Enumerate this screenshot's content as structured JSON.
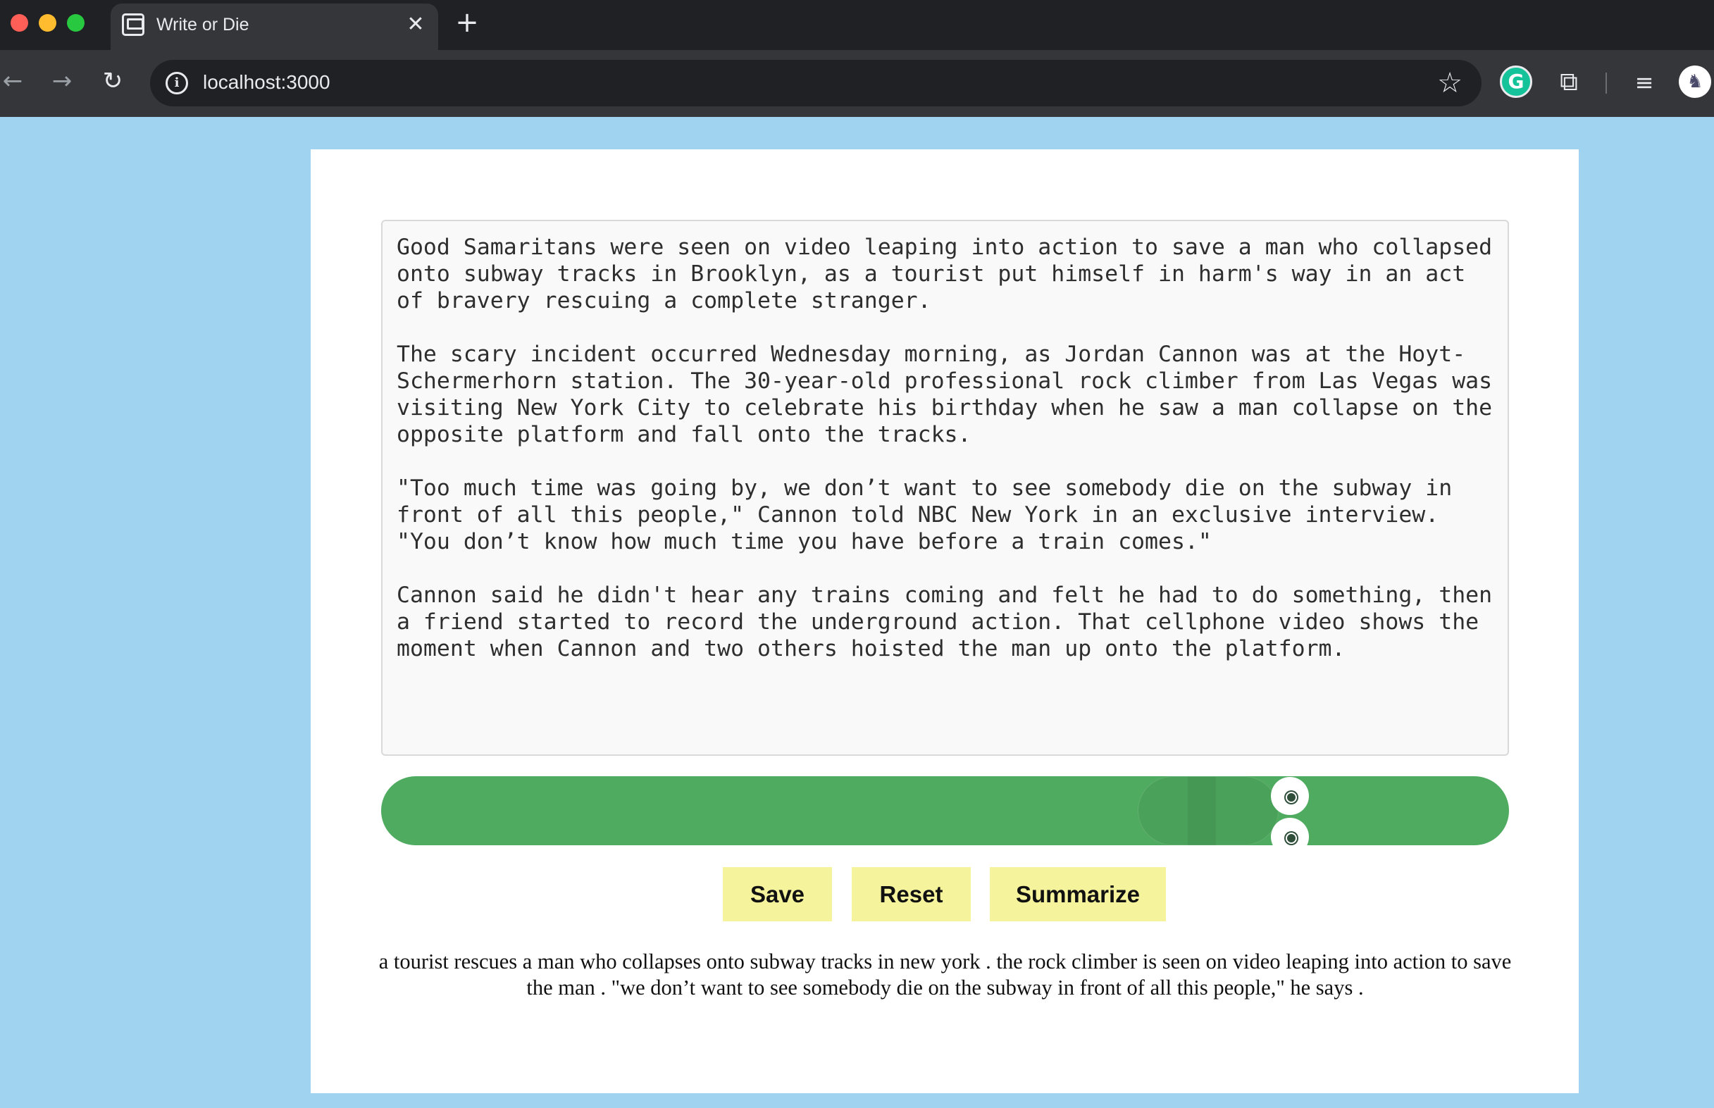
{
  "browser": {
    "tab_title": "Write or Die",
    "tab_close": "✕",
    "new_tab": "+",
    "url": "localhost:3000",
    "icons": {
      "back": "←",
      "forward": "→",
      "reload": "↻",
      "info": "i",
      "bookmark": "☆",
      "grammarly": "G",
      "extensions": "⧉",
      "media": "≡",
      "profile": "♞"
    }
  },
  "editor": {
    "text": "Good Samaritans were seen on video leaping into action to save a man who collapsed onto subway tracks in Brooklyn, as a tourist put himself in harm's way in an act of bravery rescuing a complete stranger.\n\nThe scary incident occurred Wednesday morning, as Jordan Cannon was at the Hoyt-Schermerhorn station. The 30-year-old professional rock climber from Las Vegas was visiting New York City to celebrate his birthday when he saw a man collapse on the opposite platform and fall onto the tracks.\n\n\"Too much time was going by, we don’t want to see somebody die on the subway in front of all this people,\" Cannon told NBC New York in an exclusive interview. \"You don’t know how much time you have before a train comes.\"\n\nCannon said he didn't hear any trains coming and felt he had to do something, then a friend started to record the underground action. That cellphone video shows the moment when Cannon and two others hoisted the man up onto the platform."
  },
  "timer": {
    "color": "#4fab5f"
  },
  "buttons": {
    "save": "Save",
    "reset": "Reset",
    "summarize": "Summarize",
    "color": "#f5f39b"
  },
  "summary": {
    "text": "a tourist rescues a man who collapses onto subway tracks in new york . the rock climber is seen on video leaping into action to save the man . \"we don’t want to see somebody die on the subway in front of all this people,\" he says ."
  },
  "colors": {
    "page_background": "#9fd3f0",
    "card_background": "#ffffff"
  }
}
